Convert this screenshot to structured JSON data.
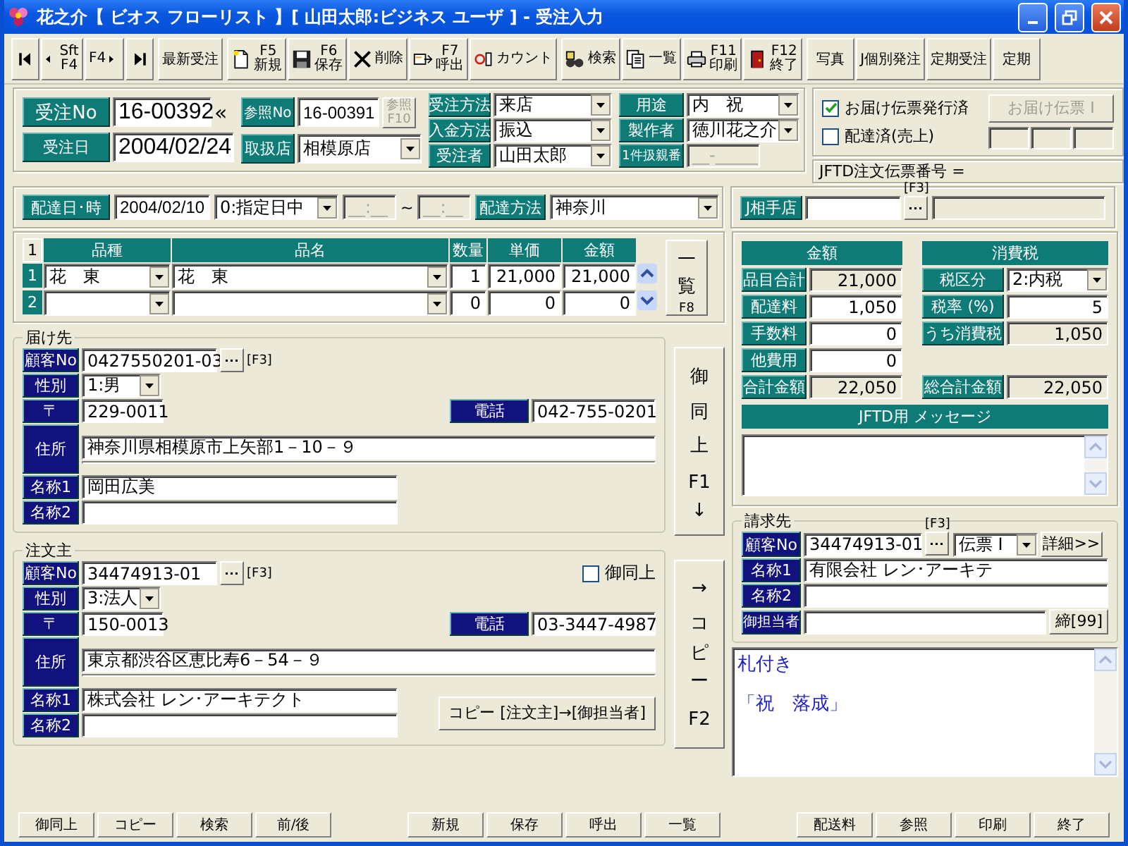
{
  "window": {
    "title": "花之介【 ビオス フローリスト 】[ 山田太郎:ビジネス ユーザ ] - 受注入力"
  },
  "toolbar": [
    [
      {
        "kind": "first"
      },
      {
        "kind": "prev",
        "keys": [
          "Sft",
          "F4"
        ]
      },
      {
        "kind": "next",
        "keys": [
          "F4"
        ]
      },
      {
        "kind": "last"
      }
    ],
    [
      {
        "kind": "text",
        "label": "最新受注"
      }
    ],
    [
      {
        "kind": "new",
        "keys": [
          "F5"
        ],
        "label": "新規"
      },
      {
        "kind": "save",
        "keys": [
          "F6"
        ],
        "label": "保存"
      },
      {
        "kind": "delete",
        "label": "削除"
      },
      {
        "kind": "call",
        "keys": [
          "F7"
        ],
        "label": "呼出"
      },
      {
        "kind": "count",
        "label": "カウント"
      }
    ],
    [
      {
        "kind": "search",
        "label": "検索"
      },
      {
        "kind": "list",
        "label": "一覧"
      },
      {
        "kind": "print",
        "keys": [
          "F11"
        ],
        "label": "印刷"
      },
      {
        "kind": "exit",
        "keys": [
          "F12"
        ],
        "label": "終了"
      }
    ],
    [
      {
        "kind": "text",
        "label": "写真"
      },
      {
        "kind": "text",
        "label": "J個別発注"
      },
      {
        "kind": "text",
        "label": "定期受注"
      },
      {
        "kind": "text",
        "label": "定期"
      }
    ]
  ],
  "order": {
    "no": {
      "label": "受注No",
      "value": "16-00392"
    },
    "ref_mark": "«",
    "ref_no": {
      "label": "参照No",
      "value": "16-00391"
    },
    "ref_button": {
      "label": "参照",
      "key": "F10",
      "disabled": true
    },
    "date": {
      "label": "受注日",
      "value": "2004/02/24"
    },
    "store": {
      "label": "取扱店",
      "value": "相模原店"
    },
    "methods": [
      {
        "label": "受注方法",
        "value": "来店"
      },
      {
        "label": "入金方法",
        "value": "振込"
      },
      {
        "label": "受注者",
        "value": "山田太郎"
      }
    ],
    "details": [
      {
        "label": "用途",
        "kind": "select",
        "value": "内　祝"
      },
      {
        "label": "製作者",
        "kind": "select",
        "value": "徳川花之介"
      },
      {
        "label": "1件扱親番",
        "kind": "mask",
        "placeholder": "__-_____",
        "disabled": true
      }
    ]
  },
  "slip": {
    "checks": [
      {
        "label": "お届け伝票発行済",
        "checked": true
      },
      {
        "label": "配達済(売上)",
        "checked": false
      }
    ],
    "button": {
      "label": "お届け伝票 Ⅰ",
      "disabled": true
    }
  },
  "jftd_slip": "JFTD注文伝票番号 =",
  "delivery": {
    "label": "配達日･時",
    "date": "2004/02/10",
    "slot": "0:指定日中",
    "time_from": {
      "placeholder": "__:__"
    },
    "tilde": "~",
    "time_to": {
      "placeholder": "__:__"
    },
    "method_label": "配達方法",
    "method": "神奈川"
  },
  "partner": {
    "label": "J相手店",
    "hint": "[F3]"
  },
  "items": {
    "corner": "1",
    "columns": [
      "品種",
      "品名",
      "数量",
      "単価",
      "金額"
    ],
    "rows": [
      {
        "no": "1",
        "category": "花　東",
        "name": "花　東",
        "qty": "1",
        "price": "21,000",
        "amount": "21,000"
      },
      {
        "no": "2",
        "qty": "0",
        "price": "0",
        "amount": "0"
      }
    ],
    "list_button": {
      "label": "一覧",
      "key": "F8"
    }
  },
  "recipient": {
    "title": "届け先",
    "customer": {
      "label": "顧客No",
      "value": "0427550201-03",
      "hint": "[F3]"
    },
    "gender": {
      "label": "性別",
      "value": "1:男"
    },
    "zip": {
      "label": "〒",
      "value": "229-0011"
    },
    "phone": {
      "label": "電話",
      "value": "042-755-0201"
    },
    "address": {
      "label": "住所",
      "lines": [
        "神奈川県相模原市上矢部1－10－９"
      ]
    },
    "names": [
      {
        "label": "名称1",
        "value": "岡田広美"
      },
      {
        "label": "名称2"
      }
    ]
  },
  "same_button": {
    "label": "御同上",
    "key": "F1",
    "arrow": "↓"
  },
  "orderer": {
    "title": "注文主",
    "customer": {
      "label": "顧客No",
      "value": "34474913-01",
      "hint": "[F3]"
    },
    "same": {
      "label": "御同上",
      "checked": false
    },
    "gender": {
      "label": "性別",
      "value": "3:法人"
    },
    "zip": {
      "label": "〒",
      "value": "150-0013"
    },
    "phone": {
      "label": "電話",
      "value": "03-3447-4987"
    },
    "address": {
      "label": "住所",
      "lines": [
        "東京都渋谷区恵比寿6－54－９"
      ]
    },
    "names": [
      {
        "label": "名称1",
        "value": "株式会社 レン･アーキテクト"
      },
      {
        "label": "名称2"
      }
    ],
    "copy_button": "コピー [注文主]→[御担当者]"
  },
  "copy_side_button": {
    "arrow": "→",
    "label": "コピー",
    "key": "F2"
  },
  "amounts": {
    "title": "金額",
    "rows": [
      {
        "label": "品目合計",
        "value": "21,000",
        "readonly": true
      },
      {
        "label": "配達料",
        "value": "1,050",
        "readonly": false
      },
      {
        "label": "手数料",
        "value": "0",
        "readonly": false
      },
      {
        "label": "他費用",
        "value": "0",
        "readonly": false
      },
      {
        "label": "合計金額",
        "value": "22,050",
        "readonly": true
      }
    ]
  },
  "tax": {
    "title": "消費税",
    "rows": [
      {
        "label": "税区分",
        "kind": "select",
        "value": "2:内税"
      },
      {
        "label": "税率 (%)",
        "kind": "input",
        "value": "5"
      },
      {
        "label": "うち消費税",
        "kind": "readonly",
        "value": "1,050"
      }
    ],
    "total": {
      "label": "総合計金額",
      "value": "22,050"
    }
  },
  "message": {
    "title": "JFTD用 メッセージ"
  },
  "billing": {
    "title": "請求先",
    "hint": "[F3]",
    "customer": {
      "label": "顧客No",
      "value": "34474913-01"
    },
    "slip_type": "伝票 Ⅰ",
    "detail_button": "詳細>>",
    "names": [
      {
        "label": "名称1",
        "value": "有限会社 レン･アーキテ"
      },
      {
        "label": "名称2"
      }
    ],
    "contact": {
      "label": "御担当者",
      "button": "締[99]"
    }
  },
  "memo": [
    "札付き",
    "「祝　落成」"
  ],
  "function_keys": [
    [
      "御同上",
      "コピー",
      "検索",
      "前/後"
    ],
    [
      "新規",
      "保存",
      "呼出",
      "一覧"
    ],
    [
      "配送料",
      "参照",
      "印刷",
      "終了"
    ]
  ]
}
